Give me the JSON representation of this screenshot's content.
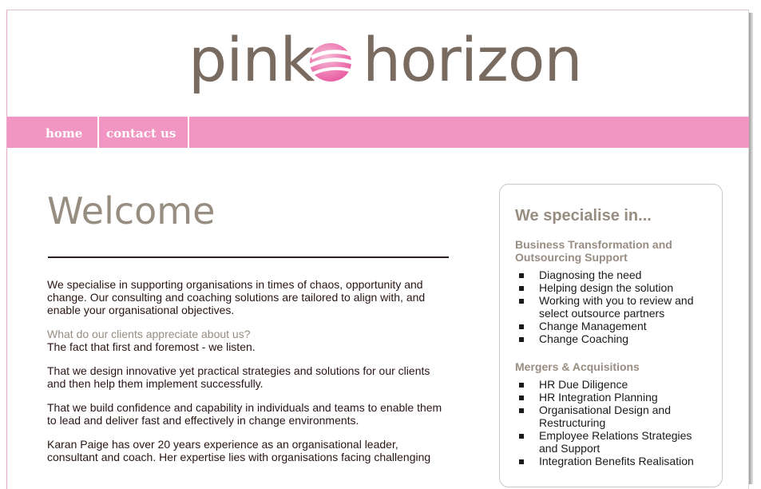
{
  "logo": {
    "word1": "pink",
    "word2": "horizon",
    "mark_icon": "horizon-swoosh-icon",
    "color_text": "#7a6b61",
    "color_mark": "#ee6fae"
  },
  "nav": {
    "items": [
      {
        "label": "home"
      },
      {
        "label": "contact us"
      }
    ],
    "background": "#f196c2"
  },
  "main": {
    "title": "Welcome",
    "paragraphs": [
      "We specialise in supporting organisations in times of chaos, opportunity and change. Our consulting and coaching solutions are tailored to align with, and enable your organisational objectives.",
      "What do our clients appreciate about us?",
      "The fact that first and foremost - we listen.",
      "That we design innovative yet practical strategies and solutions for our clients and then help them implement successfully.",
      "That we build confidence and capability in individuals and teams to enable them to lead and deliver fast and effectively in change environments.",
      "Karan Paige has over 20 years experience as an organisational leader, consultant and coach. Her expertise lies with organisations facing challenging"
    ]
  },
  "sidebar": {
    "title": "We specialise in...",
    "sections": [
      {
        "heading": "Business Transformation and Outsourcing Support",
        "items": [
          "Diagnosing the need",
          "Helping design the solution",
          "Working with you to review and select outsource partners",
          "Change Management",
          "Change Coaching"
        ]
      },
      {
        "heading": "Mergers & Acquisitions",
        "items": [
          "HR Due Diligence",
          "HR Integration Planning",
          "Organisational Design and Restructuring",
          "Employee Relations Strategies and Support",
          "Integration Benefits Realisation"
        ]
      }
    ]
  }
}
